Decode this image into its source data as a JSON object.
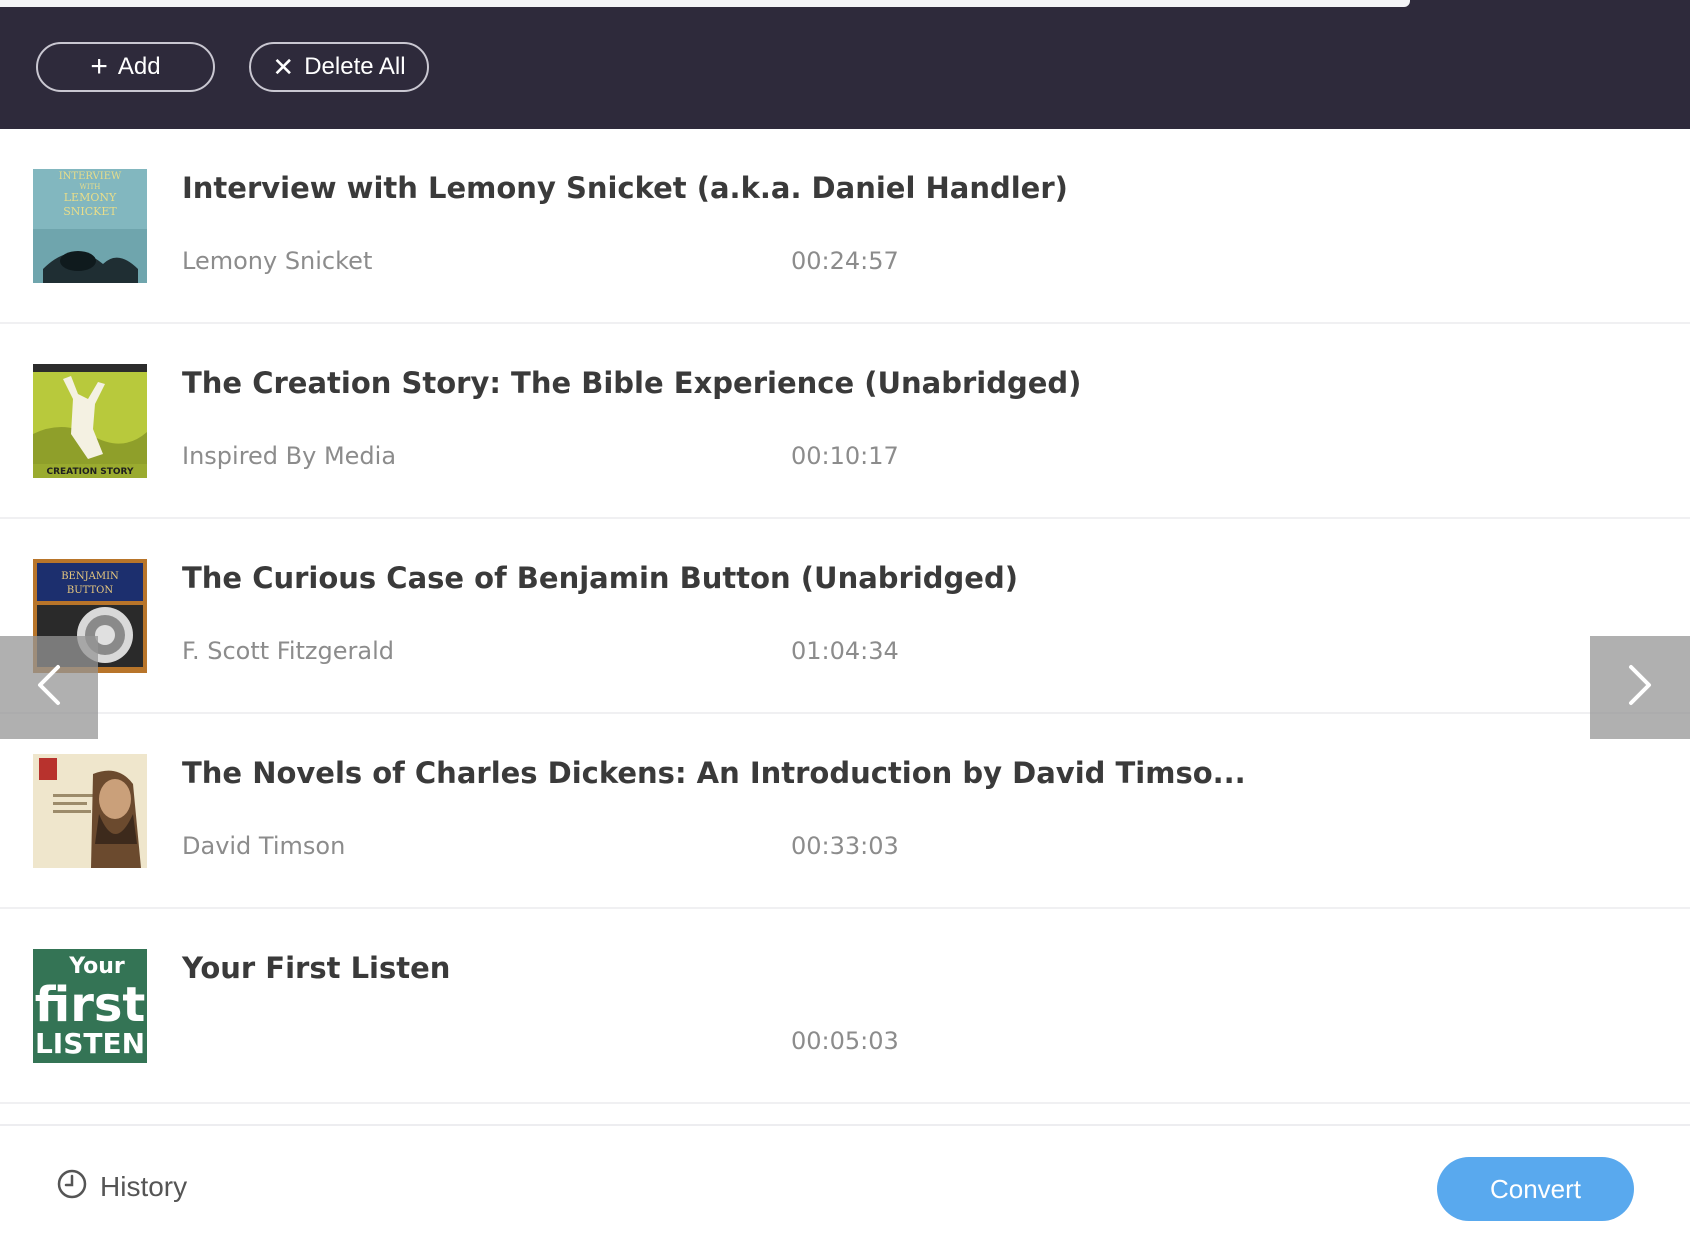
{
  "toolbar": {
    "add_label": "Add",
    "add_icon": "plus-icon",
    "delete_all_label": "Delete All",
    "delete_icon": "close-icon"
  },
  "books": [
    {
      "title": "Interview with Lemony Snicket (a.k.a. Daniel Handler)",
      "author": "Lemony Snicket",
      "duration": "00:24:57",
      "cover_text": [
        "INTERVIEW",
        "WITH",
        "LEMONY",
        "SNICKET"
      ]
    },
    {
      "title": "The Creation Story: The Bible Experience (Unabridged)",
      "author": "Inspired By Media",
      "duration": "00:10:17",
      "cover_text": [
        "CREATION STORY"
      ]
    },
    {
      "title": "The Curious Case of Benjamin Button (Unabridged)",
      "author": "F. Scott Fitzgerald",
      "duration": "01:04:34",
      "cover_text": [
        "BENJAMIN",
        "BUTTON"
      ]
    },
    {
      "title": "The Novels of Charles Dickens: An Introduction by David Timso...",
      "author": "David Timson",
      "duration": "00:33:03",
      "cover_text": []
    },
    {
      "title": "Your First Listen",
      "author": "",
      "duration": "00:05:03",
      "cover_text": [
        "Your",
        "first",
        "LISTEN"
      ]
    }
  ],
  "navigation": {
    "prev_icon": "chevron-left-icon",
    "next_icon": "chevron-right-icon"
  },
  "footer": {
    "history_label": "History",
    "history_icon": "clock-icon",
    "convert_label": "Convert"
  },
  "colors": {
    "toolbar_bg": "#2e2a3b",
    "convert_bg": "#59a9ee",
    "title_text": "#3a3a3a",
    "meta_text": "#8c8c8c"
  }
}
